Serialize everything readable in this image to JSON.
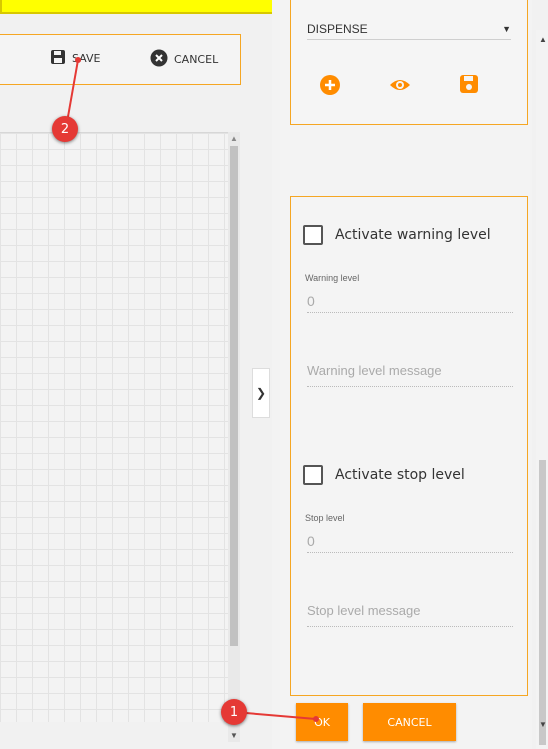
{
  "toolbar": {
    "save_label": "SAVE",
    "cancel_label": "CANCEL"
  },
  "dispense": {
    "selected": "DISPENSE",
    "dropdown_icon": "caret-down"
  },
  "levels": {
    "warning_checkbox_label": "Activate warning level",
    "warning_level_label": "Warning level",
    "warning_level_value": "0",
    "warning_message_placeholder": "Warning level message",
    "stop_checkbox_label": "Activate stop level",
    "stop_level_label": "Stop level",
    "stop_level_value": "0",
    "stop_message_placeholder": "Stop level message"
  },
  "footer": {
    "ok_label": "OK",
    "cancel_label": "CANCEL"
  },
  "callouts": [
    "1",
    "2"
  ],
  "colors": {
    "accent": "#ff8c00",
    "border_accent": "#f5a623",
    "callout": "#e53935",
    "highlight": "#ffff00"
  }
}
